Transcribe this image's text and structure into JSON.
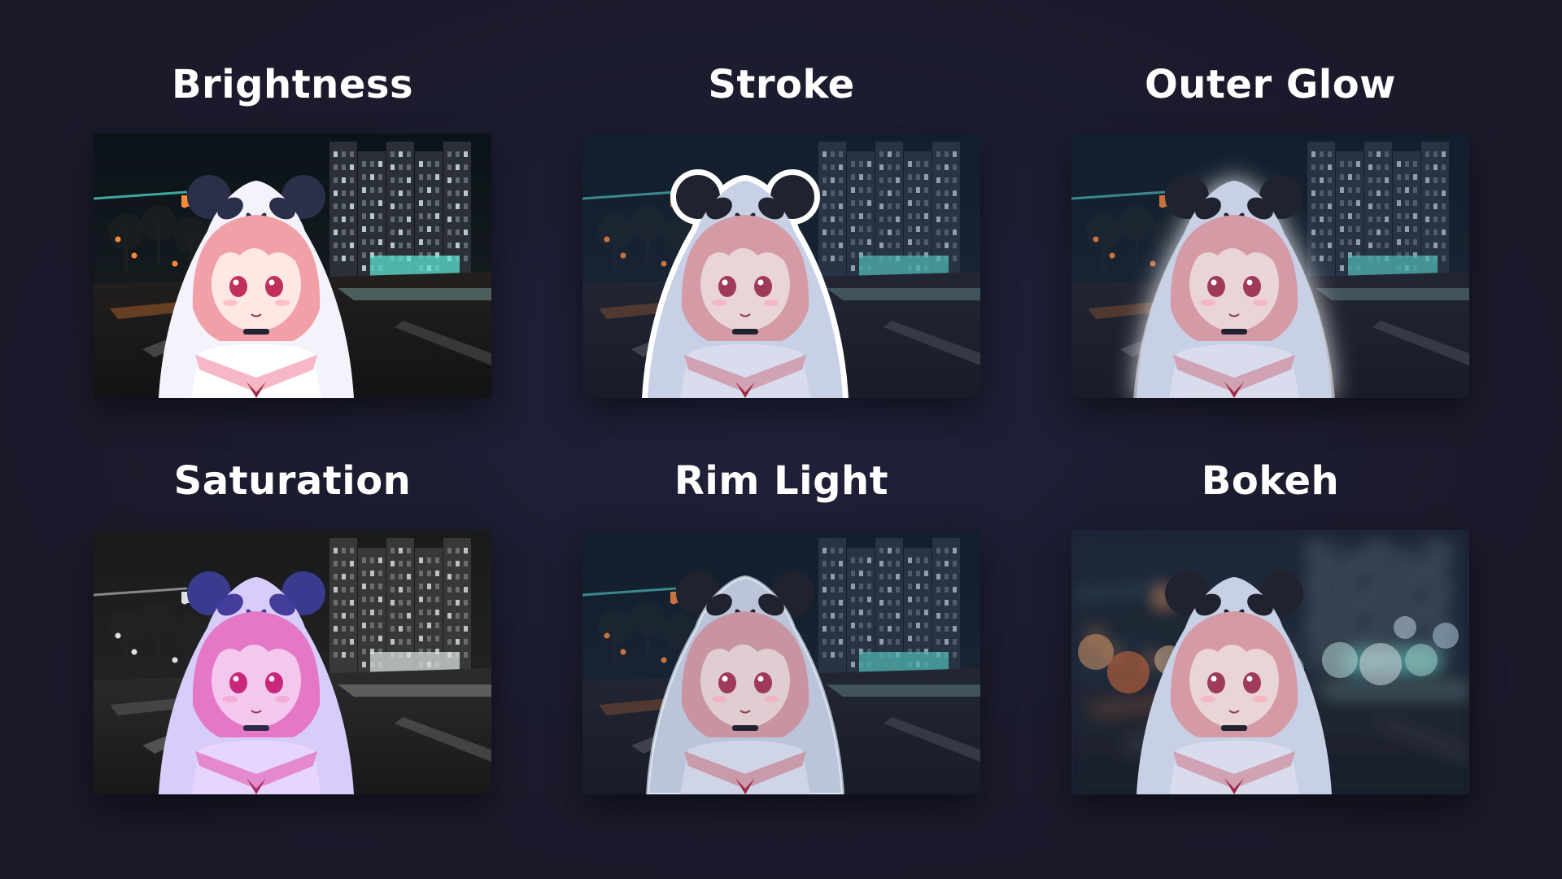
{
  "panels": [
    {
      "label": "Brightness",
      "effect": "brightness"
    },
    {
      "label": "Stroke",
      "effect": "stroke"
    },
    {
      "label": "Outer Glow",
      "effect": "outer-glow"
    },
    {
      "label": "Saturation",
      "effect": "saturation"
    },
    {
      "label": "Rim Light",
      "effect": "rim-light"
    },
    {
      "label": "Bokeh",
      "effect": "bokeh"
    }
  ],
  "colors": {
    "background": "#1c1c2e",
    "title": "#ffffff"
  }
}
